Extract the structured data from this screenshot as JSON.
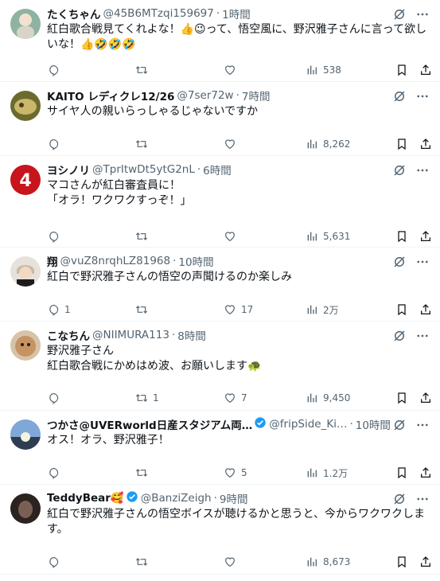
{
  "icons": {
    "grok": "grok-icon",
    "more": "more-icon",
    "reply": "reply-icon",
    "retweet": "retweet-icon",
    "like": "like-icon",
    "views": "views-icon",
    "bookmark": "bookmark-icon",
    "share": "share-icon"
  },
  "colors": {
    "text": "#0f1419",
    "muted": "#536471",
    "verified": "#1d9bf0",
    "divider": "#eff3f4"
  },
  "tweets": [
    {
      "name": "たくちゃん",
      "handle": "@45B6MTzqi159697",
      "time": "1時間",
      "text": "紅白歌合戦見てくれよな！👍😉って、悟空風に、野沢雅子さんに言って欲しいな！👍🤣🤣🤣",
      "reply": "",
      "retweet": "",
      "like": "",
      "views": "538"
    },
    {
      "name": "KAITO レディクレ12/26",
      "handle": "@7ser72w",
      "time": "7時間",
      "text": "サイヤ人の親いらっしゃるじゃないですか",
      "reply": "",
      "retweet": "",
      "like": "",
      "views": "8,262"
    },
    {
      "name": "ヨシノリ",
      "handle": "@TprItwDt5ytG2nL",
      "time": "6時間",
      "text": "マコさんが紅白審査員に！\n「オラ！ワクワクすっぞ！」",
      "reply": "",
      "retweet": "",
      "like": "",
      "views": "5,631"
    },
    {
      "name": "翔",
      "handle": "@vuZ8nrqhLZ81968",
      "time": "10時間",
      "text": "紅白で野沢雅子さんの悟空の声聞けるのか楽しみ",
      "reply": "1",
      "retweet": "",
      "like": "17",
      "views": "2万"
    },
    {
      "name": "こなちん",
      "handle": "@NIIMURA113",
      "time": "8時間",
      "text": "野沢雅子さん\n紅白歌合戦にかめはめ波、お願いします🐢",
      "reply": "",
      "retweet": "1",
      "like": "7",
      "views": "9,450"
    },
    {
      "name": "つかさ@UVERworld日産スタジアム両…",
      "handle": "@fripSide_Ki…",
      "time": "10時間",
      "text": "オス！オラ、野沢雅子！",
      "reply": "",
      "retweet": "",
      "like": "5",
      "views": "1.2万",
      "verified": true
    },
    {
      "name": "TeddyBear🥰",
      "handle": "@BanziZeigh",
      "time": "9時間",
      "text": "紅白で野沢雅子さんの悟空ボイスが聴けるかと思うと、今からワクワクします。",
      "reply": "",
      "retweet": "",
      "like": "",
      "views": "8,673",
      "verified": true
    }
  ]
}
